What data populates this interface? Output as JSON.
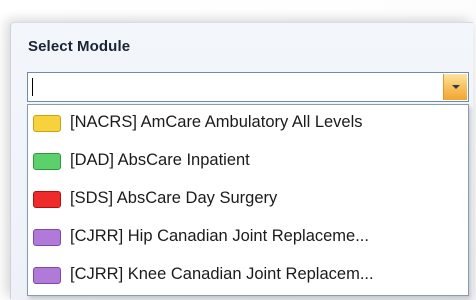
{
  "panel": {
    "title": "Select Module"
  },
  "combo": {
    "value": ""
  },
  "dropdown": {
    "items": [
      {
        "label": "[NACRS] AmCare Ambulatory All Levels",
        "color": "#f7d23c",
        "border": "#c9a21a"
      },
      {
        "label": "[DAD] AbsCare Inpatient",
        "color": "#5cd06a",
        "border": "#2e9a3c"
      },
      {
        "label": "[SDS] AbsCare Day Surgery",
        "color": "#ee2a2a",
        "border": "#b01010"
      },
      {
        "label": "[CJRR] Hip Canadian Joint Replaceme...",
        "color": "#b27ad8",
        "border": "#7d4aa8"
      },
      {
        "label": "[CJRR] Knee Canadian Joint Replacem...",
        "color": "#b27ad8",
        "border": "#7d4aa8"
      }
    ]
  }
}
